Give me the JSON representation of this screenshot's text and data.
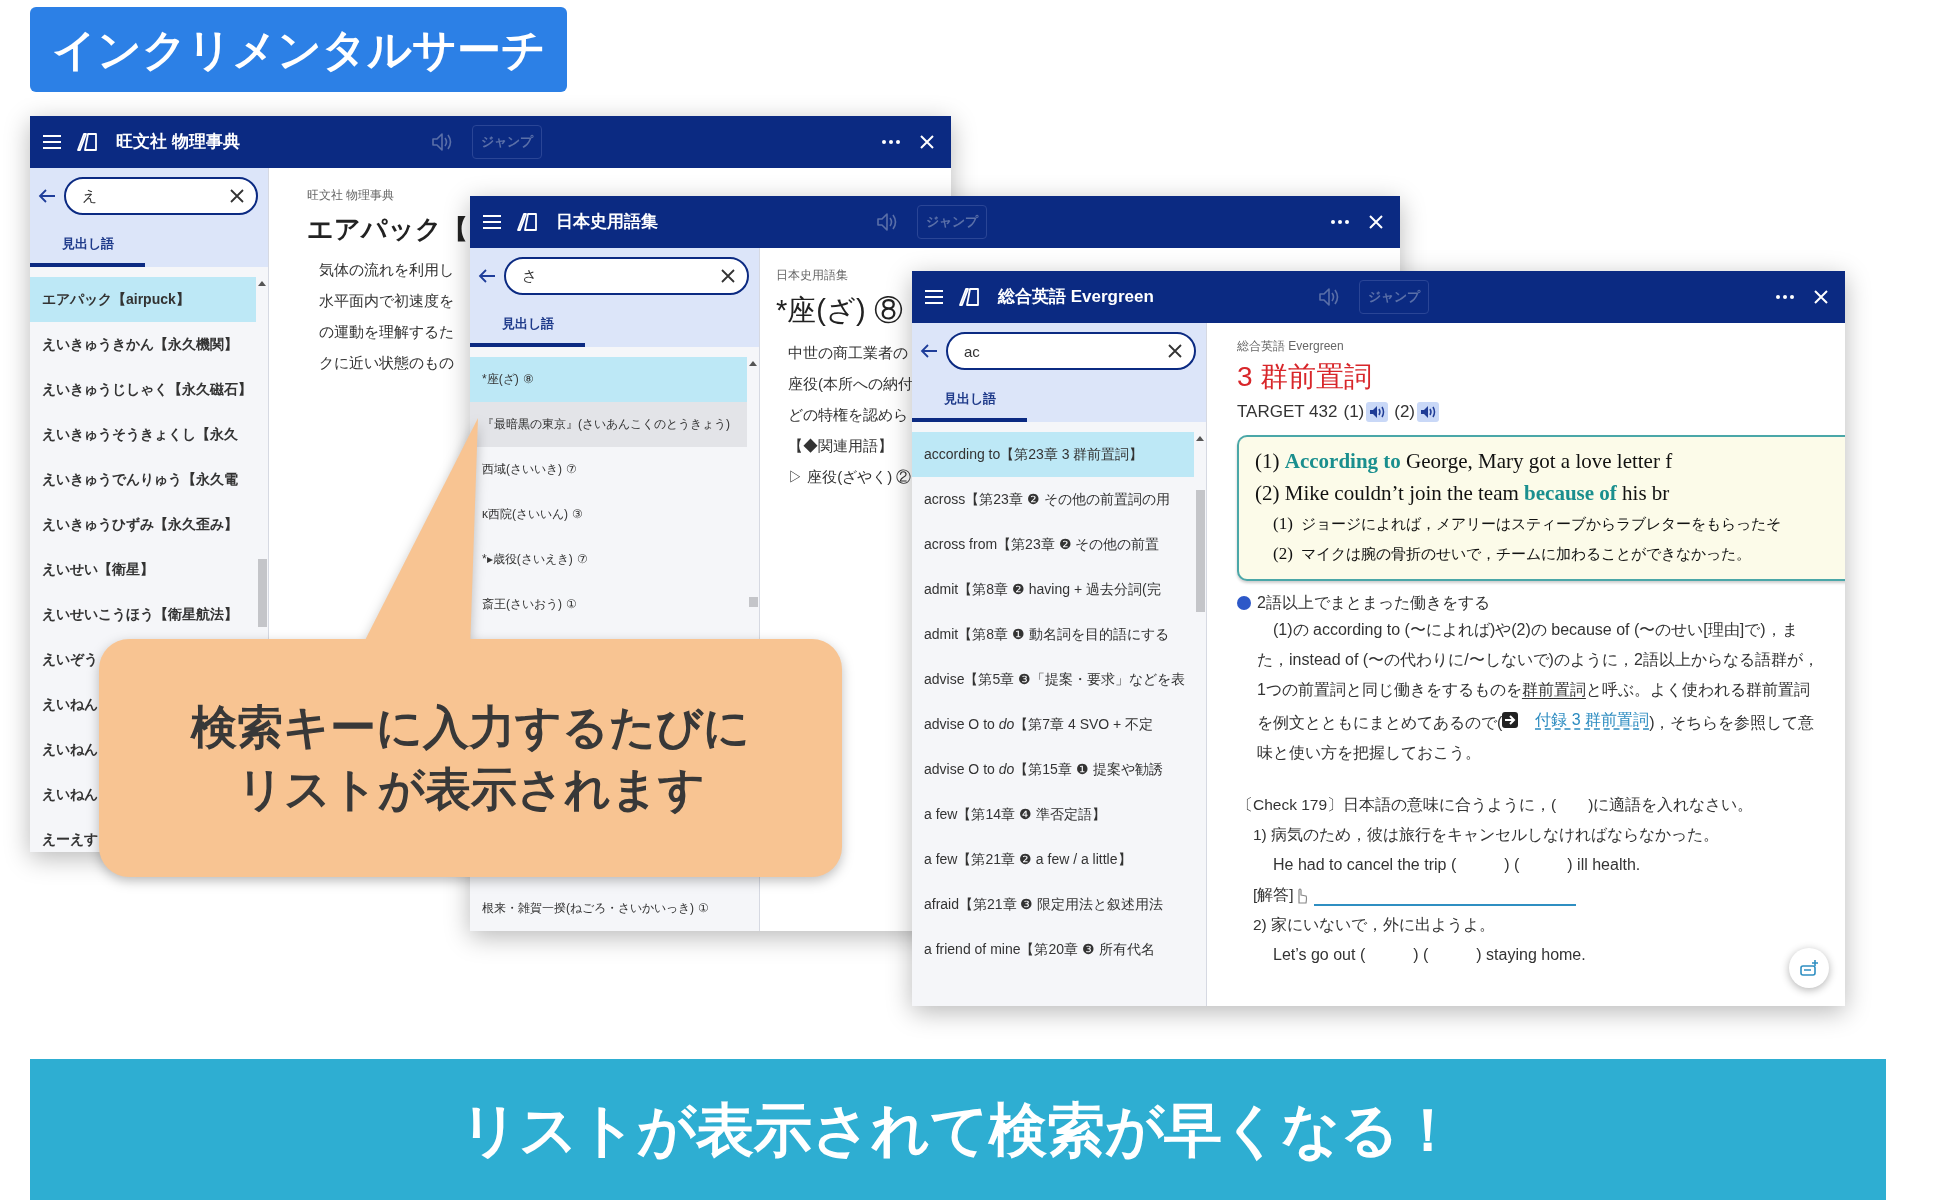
{
  "banner": {
    "title": "インクリメンタルサーチ"
  },
  "windows": [
    {
      "title": "旺文社 物理事典",
      "jump_button": "ジャンプ",
      "search": {
        "value": "え"
      },
      "tabs": [
        {
          "label": "見出し語",
          "selected": true
        }
      ],
      "list": [
        {
          "term": "エアパック【airpuck】",
          "selected": true
        },
        {
          "term": "えいきゅうきかん【永久機関】",
          "selected": false
        },
        {
          "term": "えいきゅうじしゃく【永久磁石】",
          "selected": false
        },
        {
          "term": "えいきゅうそうきょくし【永久",
          "selected": false
        },
        {
          "term": "えいきゅうでんりゅう【永久電",
          "selected": false
        },
        {
          "term": "えいきゅうひずみ【永久歪み】",
          "selected": false
        },
        {
          "term": "えいせい【衛星】",
          "selected": false
        },
        {
          "term": "えいせいこうほう【衛星航法】",
          "selected": false
        },
        {
          "term": "えいぞう",
          "selected": false
        },
        {
          "term": "えいねん",
          "selected": false
        },
        {
          "term": "えいねん",
          "selected": false
        },
        {
          "term": "えいねん",
          "selected": false
        },
        {
          "term": "えーえす",
          "selected": false
        }
      ],
      "content": {
        "kind": "definition",
        "source": "旺文社 物理事典",
        "headword": "エアパック【",
        "lines": [
          "気体の流れを利用し",
          "水平面内で初速度を",
          "の運動を理解するた",
          "クに近い状態のもの"
        ]
      }
    },
    {
      "title": "日本史用語集",
      "jump_button": "ジャンプ",
      "search": {
        "value": "さ"
      },
      "tabs": [
        {
          "label": "見出し語",
          "selected": true
        }
      ],
      "list": [
        {
          "term": "*座",
          "reading": "(ざ)",
          "number": "⑧",
          "selected": true,
          "hovered": false
        },
        {
          "term": "『最暗黒の東京』",
          "reading": "(さいあんこくのとうきょう)",
          "selected": false,
          "hovered": true
        },
        {
          "term": "西域",
          "reading": "(さいいき)",
          "number": "⑦",
          "selected": false,
          "hovered": false
        },
        {
          "term": "κ西院",
          "reading": "(さいいん)",
          "number": "③",
          "selected": false,
          "hovered": false
        },
        {
          "term": "*▸歳役",
          "reading": "(さいえき)",
          "number": "⑦",
          "selected": false,
          "hovered": false
        },
        {
          "term": "斎王",
          "reading": "(さいおう)",
          "number": "①",
          "selected": false,
          "hovered": false
        },
        {
          "term": "根来・雑賀一揆",
          "reading": "(ねごろ・さいかいっき)",
          "number": "①",
          "selected": false,
          "hovered": false
        }
      ],
      "content": {
        "kind": "definition",
        "source": "日本史用語集",
        "headword": "*座(ざ) ⑧",
        "lines": [
          "中世の商工業者の",
          "座役(本所への納付",
          "どの特権を認めら",
          "【◆関連用語】",
          "▷ 座役(ざやく) ②"
        ]
      }
    },
    {
      "title": "総合英語 Evergreen",
      "jump_button": "ジャンプ",
      "search": {
        "value": "ac"
      },
      "tabs": [
        {
          "label": "見出し語",
          "selected": true
        }
      ],
      "list": [
        {
          "term": "according to【第23章 3 群前置詞】",
          "selected": true
        },
        {
          "term": "across【第23章 ❷ その他の前置詞の用",
          "selected": false
        },
        {
          "term": "across from【第23章 ❷ その他の前置",
          "selected": false
        },
        {
          "term": "admit【第8章 ❷ having + 過去分詞(完",
          "selected": false
        },
        {
          "term": "admit【第8章 ❶ 動名詞を目的語にする",
          "selected": false
        },
        {
          "term": "advise【第5章 ❸「提案・要求」などを表",
          "selected": false
        },
        {
          "term": "advise O to *do*【第7章 4 SVO + 不定",
          "selected": false
        },
        {
          "term": "advise O to *do*【第15章 ❶ 提案や勧誘",
          "selected": false
        },
        {
          "term": "a few【第14章 ❹ 準否定語】",
          "selected": false
        },
        {
          "term": "a few【第21章 ❷ a few / a little】",
          "selected": false
        },
        {
          "term": "afraid【第21章 ❸ 限定用法と叙述用法",
          "selected": false
        },
        {
          "term": "a friend of mine【第20章 ❸ 所有代名",
          "selected": false
        }
      ],
      "content": {
        "kind": "grammar",
        "source": "総合英語 Evergreen",
        "heading": "3 群前置詞",
        "target": "TARGET 432",
        "audio": [
          "(1)",
          "(2)"
        ],
        "examples_english": [
          "(1) **According to** George, Mary got a love letter f",
          "(2) Mike couldn’t join the team **because of** his br"
        ],
        "examples_japanese": [
          {
            "num": "(1)",
            "text": "ジョージによれば，メアリーはスティーブからラブレターをもらったそ"
          },
          {
            "num": "(2)",
            "text": "マイクは腕の骨折のせいで，チームに加わることができなかった。"
          }
        ],
        "point": "2語以上でまとまった働きをする",
        "paragraph": [
          {
            "kind": "text",
            "text": "(1)の according to (〜によれば)や(2)の because of (〜のせい[理由]で)，また，instead of (〜の代わりに/〜しないで)のように，2語以上からなる語群が，1つの前置詞と同じ働きをするものを"
          },
          {
            "kind": "underline",
            "text": "群前置詞"
          },
          {
            "kind": "text",
            "text": "と呼ぶ。よく使われる群前置詞を例文とともにまとめてあるので("
          },
          {
            "kind": "link",
            "text": "付録 3 群前置詞"
          },
          {
            "kind": "text",
            "text": ")，そちらを参照して意味と使い方を把握しておこう。"
          }
        ],
        "exercise_heading": "〔Check 179〕日本語の意味に合うように，(　　)に適語を入れなさい。",
        "questions": [
          {
            "prompt": "1) 病気のため，彼は旅行をキャンセルしなければならなかった。",
            "sentence": "He had to cancel the trip (　　　) (　　　) ill health.",
            "answer_label": "[解答]"
          },
          {
            "prompt": "2) 家にいないで，外に出ようよ。",
            "sentence": "Let’s go out (　　　) (　　　) staying home."
          }
        ]
      }
    }
  ],
  "callout": {
    "lines": [
      "検索キーに入力するたびに",
      "リストが表示されます"
    ]
  },
  "footer_banner": {
    "text": "リストが表示されて検索が早くなる！"
  }
}
